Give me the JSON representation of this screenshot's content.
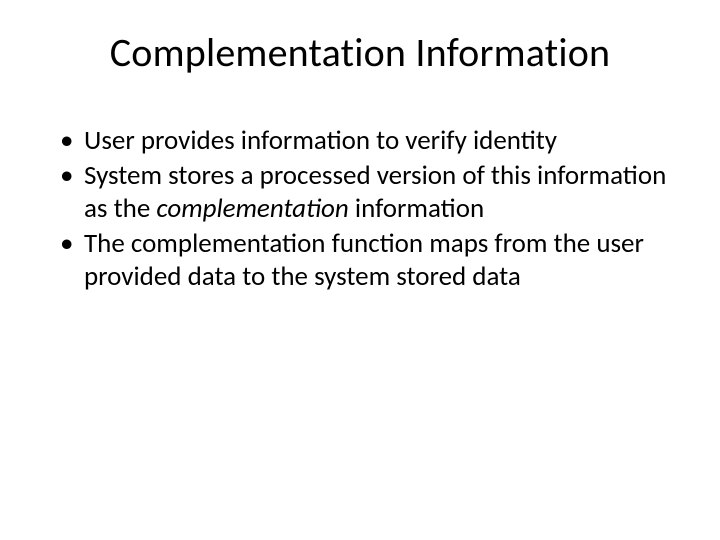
{
  "slide": {
    "title": "Complementation Information",
    "bullets": [
      {
        "text_before": "User provides information to verify identity",
        "italic": "",
        "text_after": ""
      },
      {
        "text_before": "System stores a processed version of this information as the ",
        "italic": "complementation",
        "text_after": " information"
      },
      {
        "text_before": "The complementation function maps from the user provided data to the system stored data",
        "italic": "",
        "text_after": ""
      }
    ]
  }
}
